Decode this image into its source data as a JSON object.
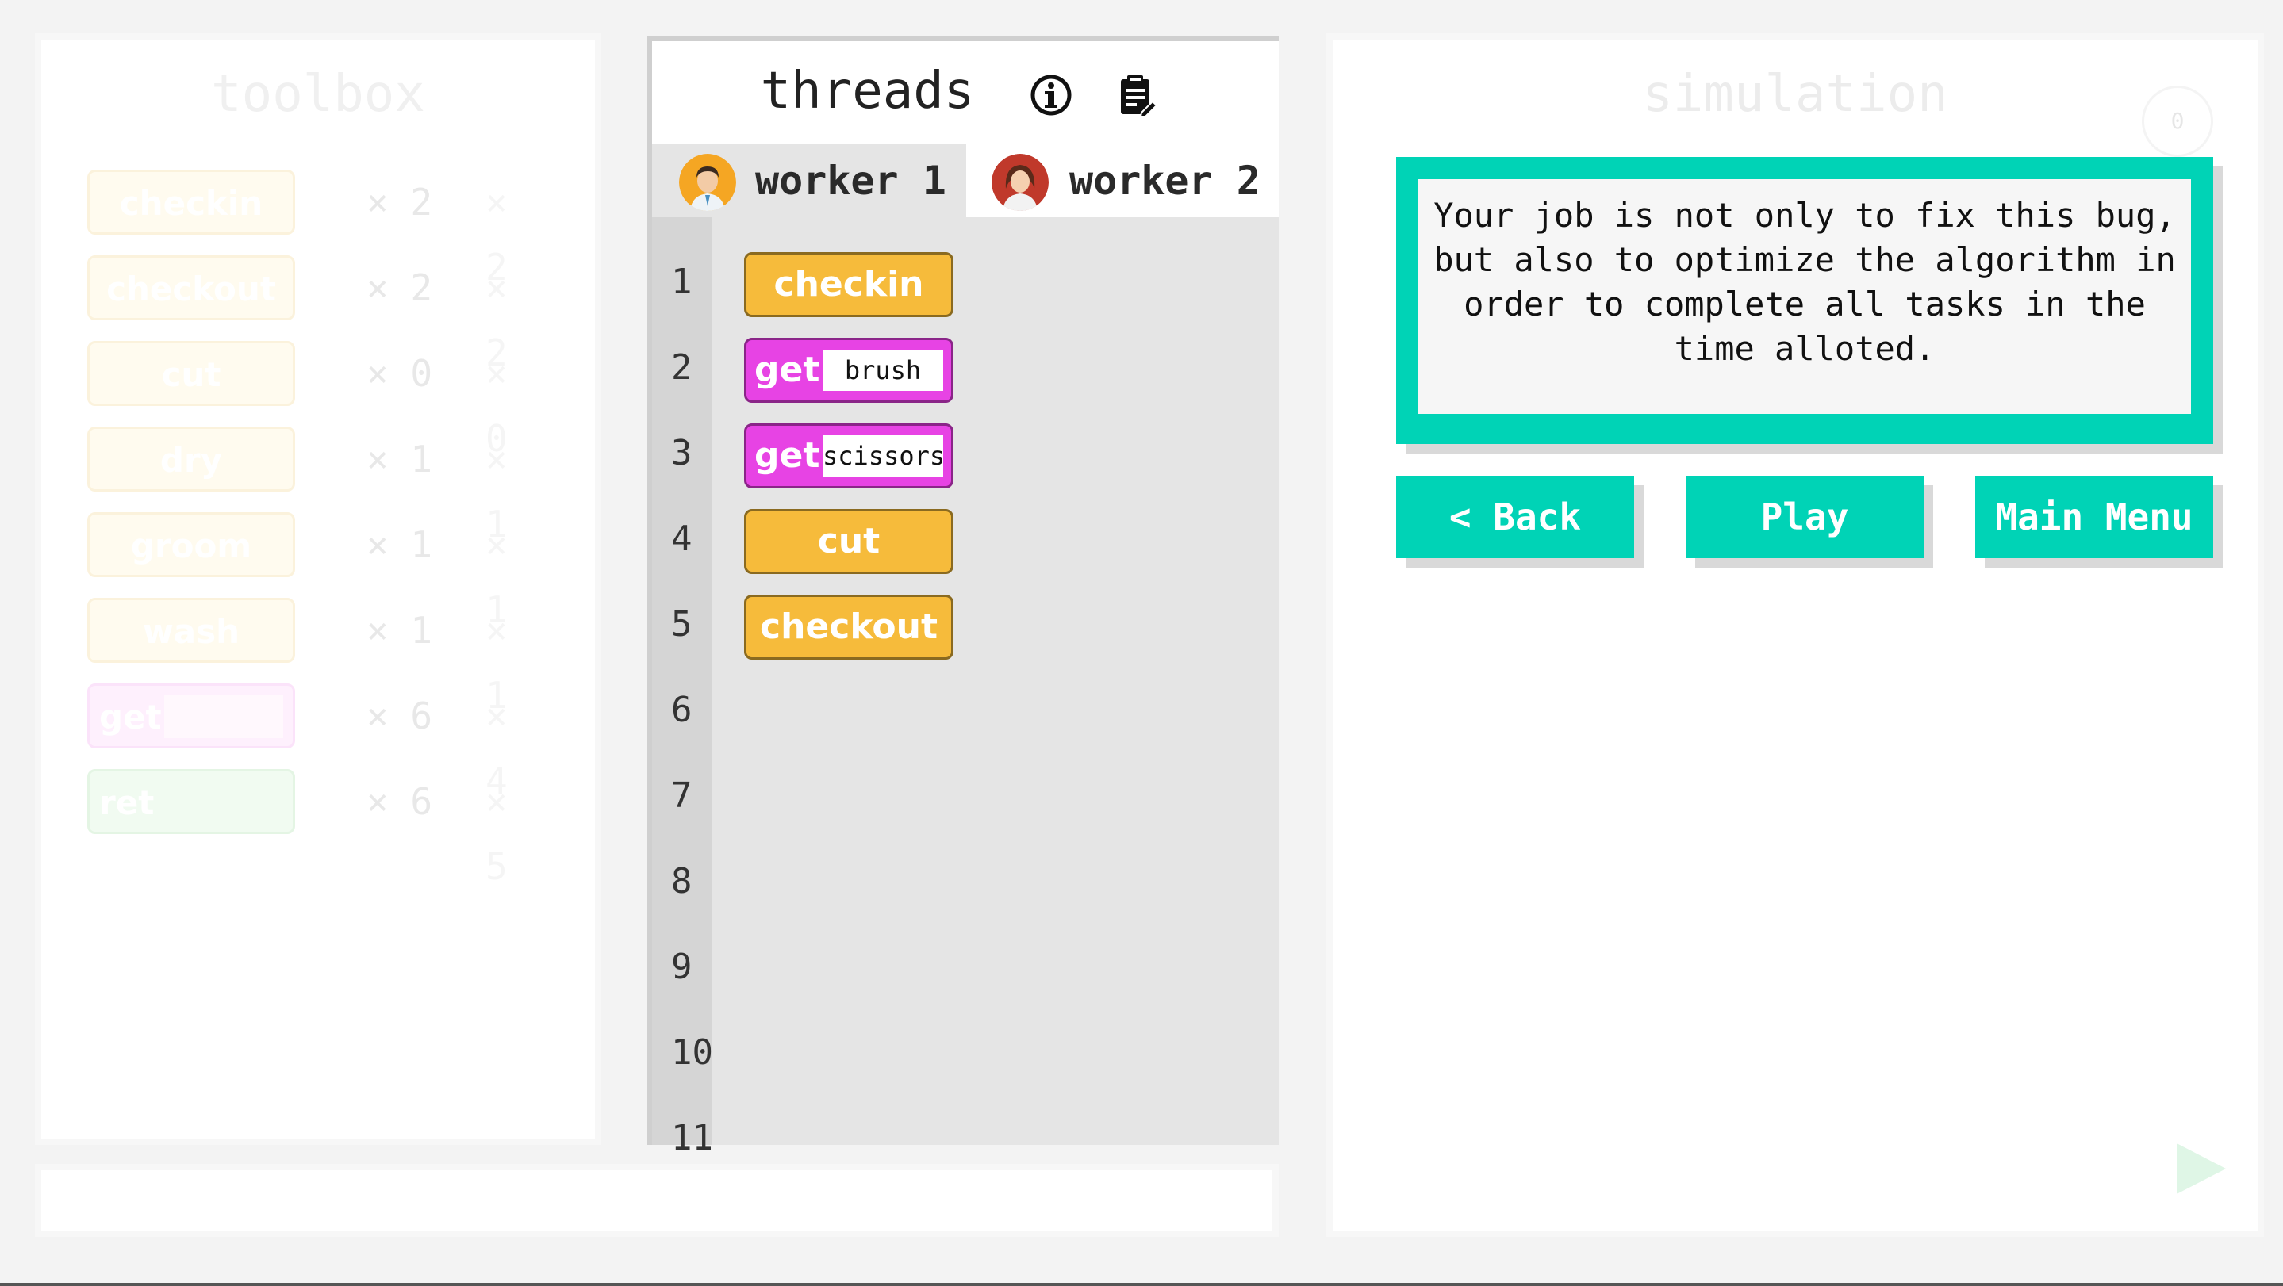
{
  "toolbox": {
    "title": "toolbox",
    "items": [
      {
        "label": "checkin",
        "count": "× 2",
        "limit": "× 2",
        "color": "yellow"
      },
      {
        "label": "checkout",
        "count": "× 2",
        "limit": "× 2",
        "color": "yellow"
      },
      {
        "label": "cut",
        "count": "× 0",
        "limit": "× 0",
        "color": "yellow"
      },
      {
        "label": "dry",
        "count": "× 1",
        "limit": "× 1",
        "color": "yellow"
      },
      {
        "label": "groom",
        "count": "× 1",
        "limit": "× 1",
        "color": "yellow"
      },
      {
        "label": "wash",
        "count": "× 1",
        "limit": "× 1",
        "color": "yellow"
      },
      {
        "label": "get",
        "count": "× 6",
        "limit": "× 4",
        "color": "magenta"
      },
      {
        "label": "ret",
        "count": "× 6",
        "limit": "× 5",
        "color": "green"
      }
    ]
  },
  "threads": {
    "title": "threads",
    "info_icon": "info-icon",
    "clipboard_icon": "clipboard-icon",
    "tabs": [
      {
        "label": "worker 1",
        "active": true
      },
      {
        "label": "worker 2",
        "active": false
      }
    ],
    "line_numbers": [
      "1",
      "2",
      "3",
      "4",
      "5",
      "6",
      "7",
      "8",
      "9",
      "10",
      "11"
    ],
    "blocks": [
      {
        "label": "checkin",
        "arg": null,
        "color": "yellow"
      },
      {
        "label": "get",
        "arg": "brush",
        "color": "magenta"
      },
      {
        "label": "get",
        "arg": "scissors",
        "color": "magenta"
      },
      {
        "label": "cut",
        "arg": null,
        "color": "yellow"
      },
      {
        "label": "checkout",
        "arg": null,
        "color": "yellow"
      }
    ]
  },
  "simulation": {
    "title": "simulation",
    "counter": "0",
    "message": "Your job is not only to fix this bug, but also to optimize the algorithm in order to complete all tasks in the time alloted.",
    "buttons": {
      "back": "< Back",
      "play": "Play",
      "main_menu": "Main Menu"
    }
  },
  "colors": {
    "accent": "#00d3b6",
    "yellow_block": "#f6bb3b",
    "magenta_block": "#e743e4",
    "code_bg": "#e5e5e5"
  }
}
